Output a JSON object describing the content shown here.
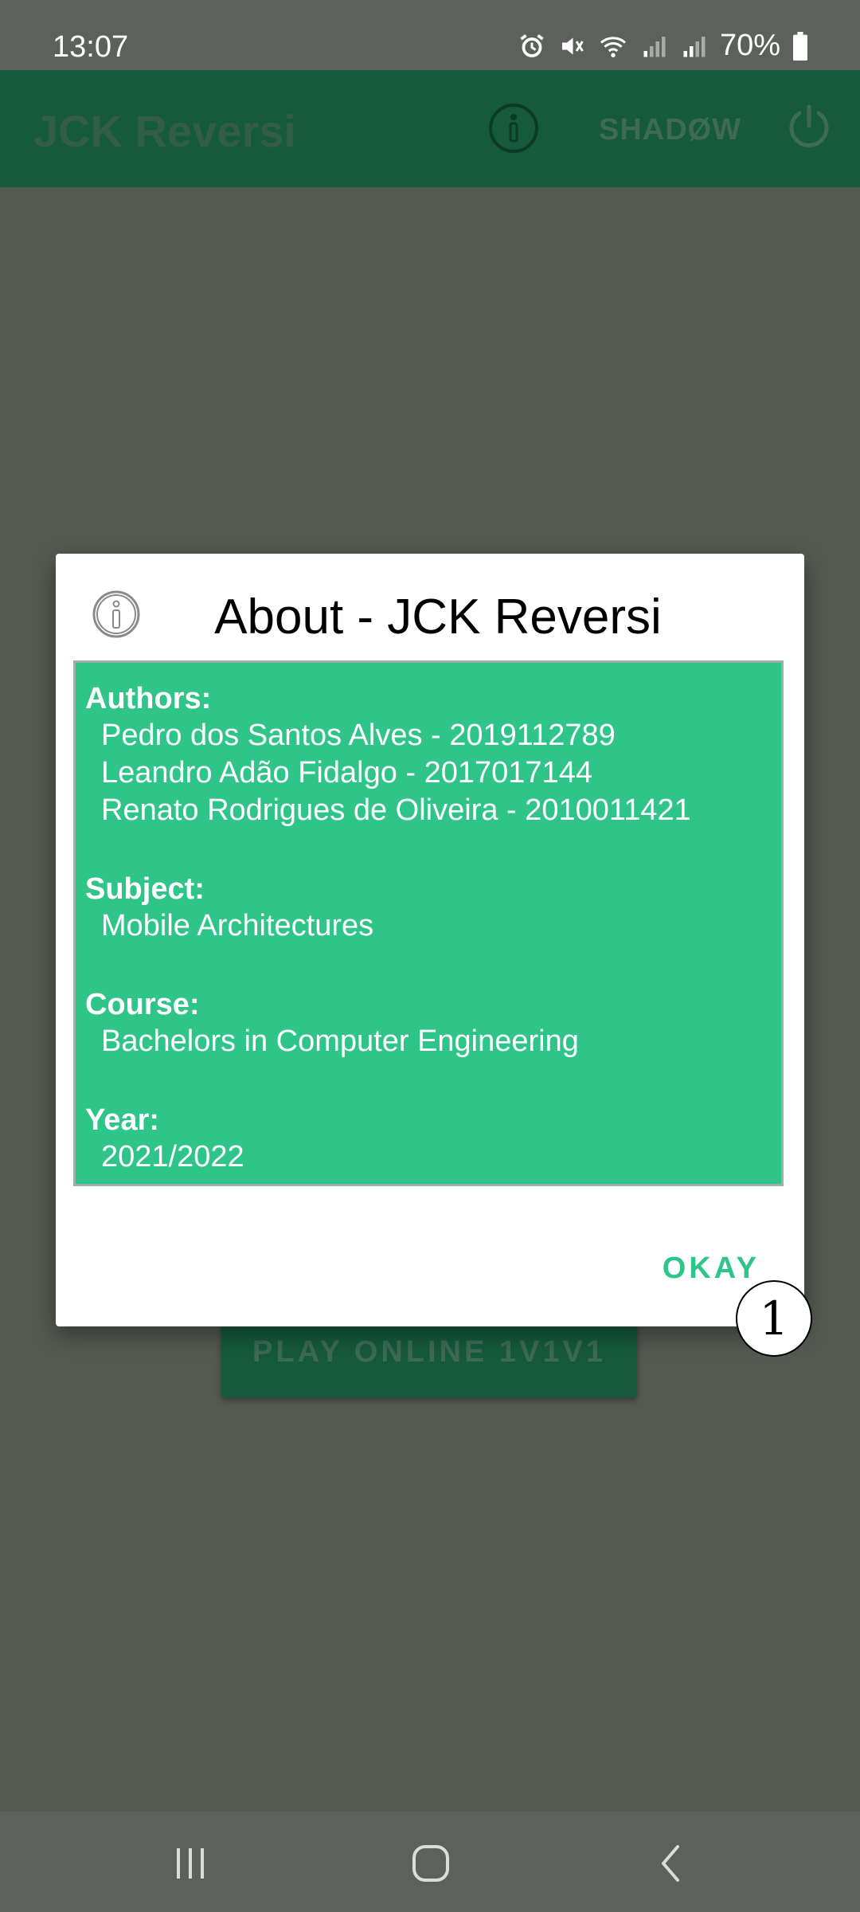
{
  "status_bar": {
    "time": "13:07",
    "battery": "70%",
    "icons": [
      "alarm-icon",
      "mute-icon",
      "wifi-icon",
      "signal-icon",
      "signal-icon",
      "battery-icon"
    ]
  },
  "app_bar": {
    "title": "JCK Reversi",
    "shadow_label": "SHADØW",
    "info_icon": "info-icon",
    "power_icon": "power-icon"
  },
  "background": {
    "play_online_label": "PLAY ONLINE 1V1V1"
  },
  "dialog": {
    "title": "About - JCK Reversi",
    "icon": "info-icon",
    "sections": {
      "authors_label": "Authors:",
      "authors": [
        "Pedro dos Santos Alves - 2019112789",
        "Leandro Adão Fidalgo - 2017017144",
        "Renato Rodrigues de Oliveira - 2010011421"
      ],
      "subject_label": "Subject:",
      "subject": "Mobile Architectures",
      "course_label": "Course:",
      "course": "Bachelors in Computer Engineering",
      "year_label": "Year:",
      "year": "2021/2022"
    },
    "okay_label": "OKAY"
  },
  "marker": {
    "label": "1"
  },
  "nav_bar": {
    "icons": [
      "recents-icon",
      "home-icon",
      "back-icon"
    ]
  },
  "colors": {
    "dialog_panel": "#2fc488",
    "app_bar": "#155a3c",
    "scrim": "#545a52",
    "accent": "#2fc488"
  }
}
